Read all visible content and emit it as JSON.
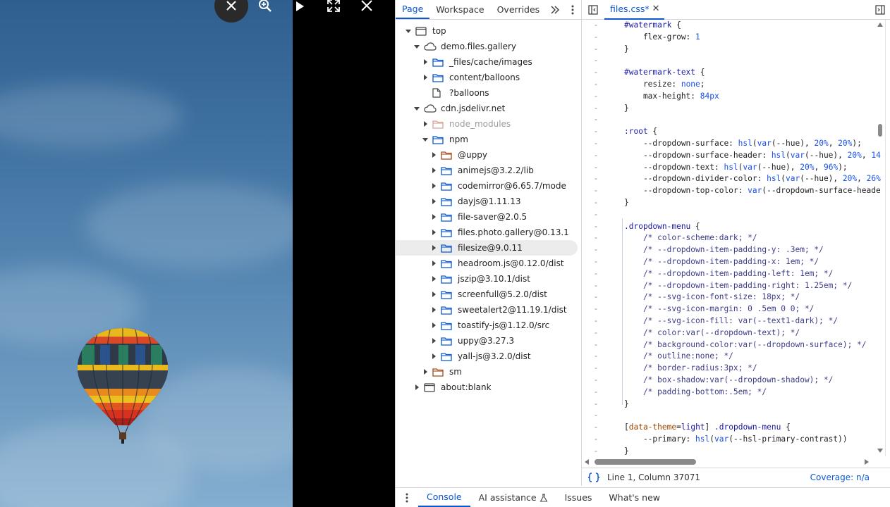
{
  "viewer": {
    "controls": [
      "close-round",
      "zoom-in",
      "play",
      "fullscreen",
      "close"
    ]
  },
  "navigator": {
    "tabs": [
      {
        "label": "Page",
        "active": true
      },
      {
        "label": "Workspace",
        "active": false
      },
      {
        "label": "Overrides",
        "active": false
      }
    ],
    "tree": [
      {
        "label": "top",
        "depth": 0,
        "icon": "frame",
        "expanded": true
      },
      {
        "label": "demo.files.gallery",
        "depth": 1,
        "icon": "cloud",
        "expanded": true
      },
      {
        "label": "_files/cache/images",
        "depth": 2,
        "icon": "folder",
        "expanded": false
      },
      {
        "label": "content/balloons",
        "depth": 2,
        "icon": "folder",
        "expanded": false
      },
      {
        "label": "?balloons",
        "depth": 2,
        "icon": "file",
        "leaf": true
      },
      {
        "label": "cdn.jsdelivr.net",
        "depth": 1,
        "icon": "cloud",
        "expanded": true
      },
      {
        "label": "node_modules",
        "depth": 2,
        "icon": "folder-dim",
        "expanded": false,
        "dim": true
      },
      {
        "label": "npm",
        "depth": 2,
        "icon": "folder",
        "expanded": true
      },
      {
        "label": "@uppy",
        "depth": 3,
        "icon": "folder-brown",
        "expanded": false
      },
      {
        "label": "animejs@3.2.2/lib",
        "depth": 3,
        "icon": "folder",
        "expanded": false
      },
      {
        "label": "codemirror@6.65.7/mode",
        "depth": 3,
        "icon": "folder",
        "expanded": false
      },
      {
        "label": "dayjs@1.11.13",
        "depth": 3,
        "icon": "folder",
        "expanded": false
      },
      {
        "label": "file-saver@2.0.5",
        "depth": 3,
        "icon": "folder",
        "expanded": false
      },
      {
        "label": "files.photo.gallery@0.13.1",
        "depth": 3,
        "icon": "folder",
        "expanded": false
      },
      {
        "label": "filesize@9.0.11",
        "depth": 3,
        "icon": "folder",
        "expanded": false,
        "selected": true
      },
      {
        "label": "headroom.js@0.12.0/dist",
        "depth": 3,
        "icon": "folder",
        "expanded": false
      },
      {
        "label": "jszip@3.10.1/dist",
        "depth": 3,
        "icon": "folder",
        "expanded": false
      },
      {
        "label": "screenfull@5.2.0/dist",
        "depth": 3,
        "icon": "folder",
        "expanded": false
      },
      {
        "label": "sweetalert2@11.19.1/dist",
        "depth": 3,
        "icon": "folder",
        "expanded": false
      },
      {
        "label": "toastify-js@1.12.0/src",
        "depth": 3,
        "icon": "folder",
        "expanded": false
      },
      {
        "label": "uppy@3.27.3",
        "depth": 3,
        "icon": "folder",
        "expanded": false
      },
      {
        "label": "yall-js@3.2.0/dist",
        "depth": 3,
        "icon": "folder",
        "expanded": false
      },
      {
        "label": "sm",
        "depth": 2,
        "icon": "folder-brown",
        "expanded": false
      },
      {
        "label": "about:blank",
        "depth": 1,
        "icon": "frame",
        "expanded": false
      }
    ]
  },
  "editor": {
    "file_tab": "files.css*",
    "lines": [
      [
        [
          "sel",
          "#watermark"
        ],
        [
          "prop",
          " {"
        ]
      ],
      [
        [
          "prop",
          "    flex-grow: "
        ],
        [
          "num",
          "1"
        ]
      ],
      [
        [
          "prop",
          "}"
        ]
      ],
      [],
      [
        [
          "sel",
          "#watermark-text"
        ],
        [
          "prop",
          " {"
        ]
      ],
      [
        [
          "prop",
          "    resize: "
        ],
        [
          "num",
          "none"
        ],
        [
          "prop",
          ";"
        ]
      ],
      [
        [
          "prop",
          "    max-height: "
        ],
        [
          "num",
          "84px"
        ]
      ],
      [
        [
          "prop",
          "}"
        ]
      ],
      [],
      [
        [
          "sel",
          ":root"
        ],
        [
          "prop",
          " {"
        ]
      ],
      [
        [
          "prop",
          "    --dropdown-surface: "
        ],
        [
          "num",
          "hsl"
        ],
        [
          "prop",
          "("
        ],
        [
          "num",
          "var"
        ],
        [
          "prop",
          "(--hue), "
        ],
        [
          "num",
          "20%"
        ],
        [
          "prop",
          ", "
        ],
        [
          "num",
          "20%"
        ],
        [
          "prop",
          ");"
        ]
      ],
      [
        [
          "prop",
          "    --dropdown-surface-header: "
        ],
        [
          "num",
          "hsl"
        ],
        [
          "prop",
          "("
        ],
        [
          "num",
          "var"
        ],
        [
          "prop",
          "(--hue), "
        ],
        [
          "num",
          "20%"
        ],
        [
          "prop",
          ", "
        ],
        [
          "num",
          "14"
        ]
      ],
      [
        [
          "prop",
          "    --dropdown-text: "
        ],
        [
          "num",
          "hsl"
        ],
        [
          "prop",
          "("
        ],
        [
          "num",
          "var"
        ],
        [
          "prop",
          "(--hue), "
        ],
        [
          "num",
          "20%"
        ],
        [
          "prop",
          ", "
        ],
        [
          "num",
          "96%"
        ],
        [
          "prop",
          ");"
        ]
      ],
      [
        [
          "prop",
          "    --dropdown-divider-color: "
        ],
        [
          "num",
          "hsl"
        ],
        [
          "prop",
          "("
        ],
        [
          "num",
          "var"
        ],
        [
          "prop",
          "(--hue), "
        ],
        [
          "num",
          "20%"
        ],
        [
          "prop",
          ", "
        ],
        [
          "num",
          "26%"
        ]
      ],
      [
        [
          "prop",
          "    --dropdown-top-color: "
        ],
        [
          "num",
          "var"
        ],
        [
          "prop",
          "(--dropdown-surface-heade"
        ]
      ],
      [
        [
          "prop",
          "}"
        ]
      ],
      [],
      [
        [
          "sel",
          ".dropdown-menu"
        ],
        [
          "prop",
          " {"
        ]
      ],
      [
        [
          "cm",
          "    /* color-scheme:dark; */"
        ]
      ],
      [
        [
          "cm",
          "    /* --dropdown-item-padding-y: .3em; */"
        ]
      ],
      [
        [
          "cm",
          "    /* --dropdown-item-padding-x: 1em; */"
        ]
      ],
      [
        [
          "cm",
          "    /* --dropdown-item-padding-left: 1em; */"
        ]
      ],
      [
        [
          "cm",
          "    /* --dropdown-item-padding-right: 1.25em; */"
        ]
      ],
      [
        [
          "cm",
          "    /* --svg-icon-font-size: 18px; */"
        ]
      ],
      [
        [
          "cm",
          "    /* --svg-icon-margin: 0 .5em 0 0; */"
        ]
      ],
      [
        [
          "cm",
          "    /* --svg-icon-fill: var(--text1-dark); */"
        ]
      ],
      [
        [
          "cm",
          "    /* color:var(--dropdown-text); */"
        ]
      ],
      [
        [
          "cm",
          "    /* background-color:var(--dropdown-surface); */"
        ]
      ],
      [
        [
          "cm",
          "    /* outline:none; */"
        ]
      ],
      [
        [
          "cm",
          "    /* border-radius:3px; */"
        ]
      ],
      [
        [
          "cm",
          "    /* box-shadow:var(--dropdown-shadow); */"
        ]
      ],
      [
        [
          "cm",
          "    /* padding-bottom:.5em; */"
        ]
      ],
      [
        [
          "prop",
          "}"
        ]
      ],
      [],
      [
        [
          "prop",
          "["
        ],
        [
          "attr",
          "data-theme"
        ],
        [
          "prop",
          "="
        ],
        [
          "sel",
          "light"
        ],
        [
          "prop",
          "] "
        ],
        [
          "sel",
          ".dropdown-menu"
        ],
        [
          "prop",
          " {"
        ]
      ],
      [
        [
          "prop",
          "    --primary: "
        ],
        [
          "num",
          "hsl"
        ],
        [
          "prop",
          "("
        ],
        [
          "num",
          "var"
        ],
        [
          "prop",
          "(--hsl-primary-contrast))"
        ]
      ],
      [
        [
          "prop",
          "}"
        ]
      ]
    ],
    "status_position": "Line 1, Column 37071",
    "coverage": "Coverage: n/a"
  },
  "drawer": {
    "tabs": [
      {
        "label": "Console",
        "active": true
      },
      {
        "label": "AI assistance",
        "active": false
      },
      {
        "label": "Issues",
        "active": false
      },
      {
        "label": "What's new",
        "active": false
      }
    ]
  }
}
